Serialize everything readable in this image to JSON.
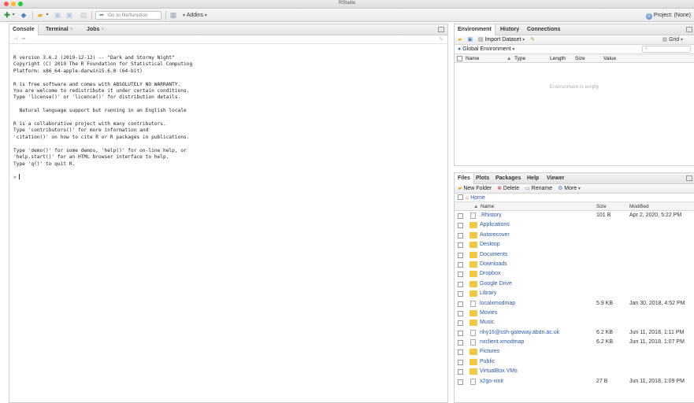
{
  "window": {
    "title": "RStudio"
  },
  "toolbar": {
    "goto_placeholder": "Go to file/function",
    "addins_label": "Addins",
    "project_label": "Project: (None)"
  },
  "console_pane": {
    "tabs": [
      {
        "label": "Console"
      },
      {
        "label": "Terminal"
      },
      {
        "label": "Jobs"
      }
    ],
    "path": "~/",
    "output": "R version 3.6.2 (2019-12-12) -- \"Dark and Stormy Night\"\nCopyright (C) 2019 The R Foundation for Statistical Computing\nPlatform: x86_64-apple-darwin15.6.0 (64-bit)\n\nR is free software and comes with ABSOLUTELY NO WARRANTY.\nYou are welcome to redistribute it under certain conditions.\nType 'license()' or 'licence()' for distribution details.\n\n  Natural language support but running in an English locale\n\nR is a collaborative project with many contributors.\nType 'contributors()' for more information and\n'citation()' on how to cite R or R packages in publications.\n\nType 'demo()' for some demos, 'help()' for on-line help, or\n'help.start()' for an HTML browser interface to help.\nType 'q()' to quit R.\n",
    "prompt": ">"
  },
  "env_pane": {
    "tabs": [
      {
        "label": "Environment"
      },
      {
        "label": "History"
      },
      {
        "label": "Connections"
      }
    ],
    "import_label": "Import Dataset",
    "grid_label": "Grid",
    "scope_label": "Global Environment",
    "columns": {
      "name": "Name",
      "type": "Type",
      "length": "Length",
      "size": "Size",
      "value": "Value"
    },
    "empty_text": "Environment is empty"
  },
  "files_pane": {
    "tabs": [
      {
        "label": "Files"
      },
      {
        "label": "Plots"
      },
      {
        "label": "Packages"
      },
      {
        "label": "Help"
      },
      {
        "label": "Viewer"
      }
    ],
    "new_folder_label": "New Folder",
    "delete_label": "Delete",
    "rename_label": "Rename",
    "more_label": "More",
    "home_label": "Home",
    "columns": {
      "name": "Name",
      "size": "Size",
      "modified": "Modified"
    },
    "files": [
      {
        "name": ".Rhistory",
        "size": "101 B",
        "modified": "Apr 2, 2020, 5:22 PM",
        "kind": "doc"
      },
      {
        "name": "Applications",
        "size": "",
        "modified": "",
        "kind": "folder"
      },
      {
        "name": "Autorecover",
        "size": "",
        "modified": "",
        "kind": "folder"
      },
      {
        "name": "Desktop",
        "size": "",
        "modified": "",
        "kind": "folder"
      },
      {
        "name": "Documents",
        "size": "",
        "modified": "",
        "kind": "folder"
      },
      {
        "name": "Downloads",
        "size": "",
        "modified": "",
        "kind": "folder"
      },
      {
        "name": "Dropbox",
        "size": "",
        "modified": "",
        "kind": "folder"
      },
      {
        "name": "Google Drive",
        "size": "",
        "modified": "",
        "kind": "folder"
      },
      {
        "name": "Library",
        "size": "",
        "modified": "",
        "kind": "folder"
      },
      {
        "name": "localxmodmap",
        "size": "5.9 KB",
        "modified": "Jan 30, 2018, 4:52 PM",
        "kind": "doc"
      },
      {
        "name": "Movies",
        "size": "",
        "modified": "",
        "kind": "folder"
      },
      {
        "name": "Music",
        "size": "",
        "modified": "",
        "kind": "folder"
      },
      {
        "name": "nhy16@ssh-gateway.abdn.ac.uk",
        "size": "6.2 KB",
        "modified": "Jun 11, 2018, 1:11 PM",
        "kind": "doc"
      },
      {
        "name": "nxclient.xmodmap",
        "size": "6.2 KB",
        "modified": "Jun 11, 2018, 1:07 PM",
        "kind": "doc"
      },
      {
        "name": "Pictures",
        "size": "",
        "modified": "",
        "kind": "folder"
      },
      {
        "name": "Public",
        "size": "",
        "modified": "",
        "kind": "folder"
      },
      {
        "name": "VirtualBox VMs",
        "size": "",
        "modified": "",
        "kind": "folder"
      },
      {
        "name": "x2go-xinit",
        "size": "27 B",
        "modified": "Jun 11, 2018, 1:09 PM",
        "kind": "doc"
      }
    ]
  }
}
